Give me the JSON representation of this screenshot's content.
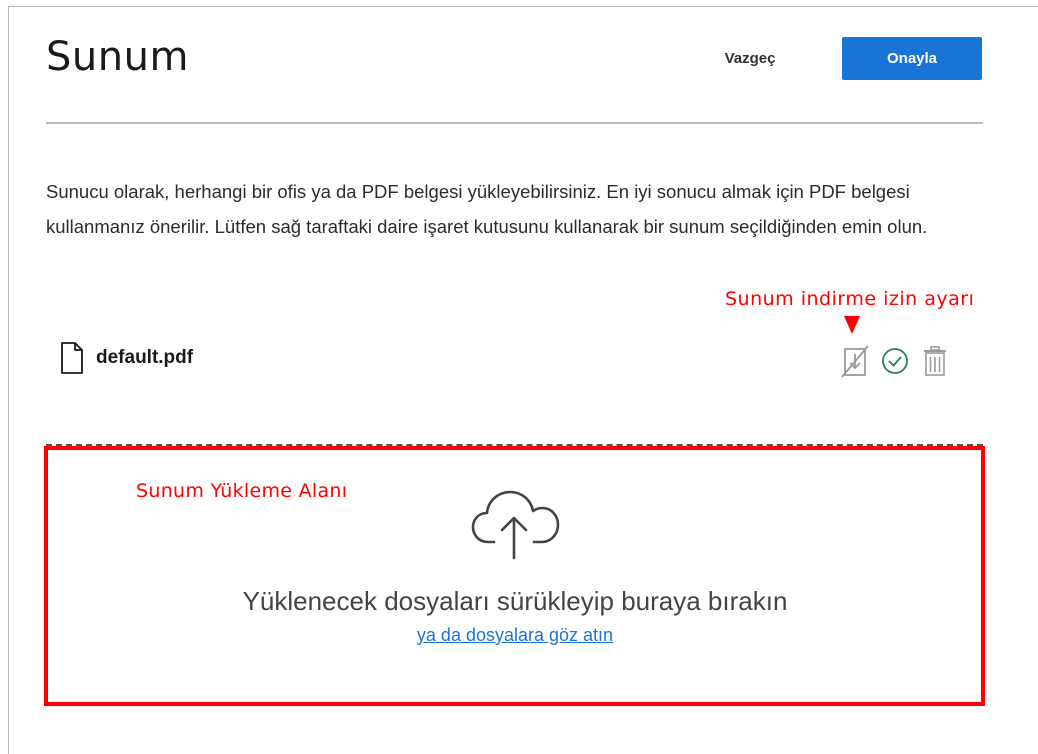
{
  "dialog": {
    "title": "Sunum",
    "cancel_label": "Vazgeç",
    "confirm_label": "Onayla",
    "description": "Sunucu olarak, herhangi bir ofis ya da PDF belgesi yükleyebilirsiniz. En iyi sonucu almak için PDF belgesi kullanmanız önerilir. Lütfen sağ taraftaki daire işaret kutusunu kullanarak bir sunum seçildiğinden emin olun."
  },
  "file": {
    "name": "default.pdf",
    "icon": "file-icon",
    "actions": [
      "download-permission-icon",
      "check-circle-icon",
      "trash-icon"
    ]
  },
  "annotations": {
    "download_setting": "Sunum indirme izin ayarı",
    "upload_area": "Sunum Yükleme Alanı"
  },
  "upload": {
    "icon": "cloud-upload-icon",
    "drop_text": "Yüklenecek dosyaları sürükleyip buraya bırakın",
    "browse_link": "ya da dosyalara göz atın"
  },
  "colors": {
    "accent": "#1a73d6",
    "annotation": "#ff0000",
    "icon_gray": "#9a9a9a",
    "check_green": "#2e7d5b"
  }
}
